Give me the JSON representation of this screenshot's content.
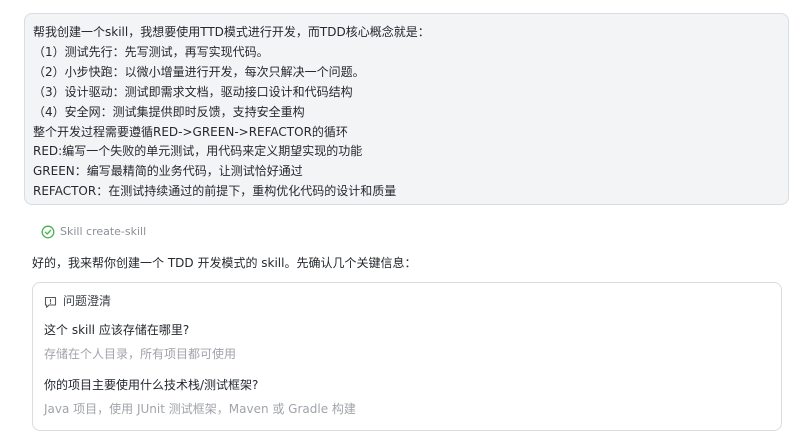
{
  "user_message": {
    "lines": [
      "帮我创建一个skill，我想要使用TTD模式进行开发，而TDD核心概念就是：",
      "（1）测试先行：先写测试，再写实现代码。",
      "（2）小步快跑：以微小增量进行开发，每次只解决一个问题。",
      "（3）设计驱动：测试即需求文档，驱动接口设计和代码结构",
      "（4）安全网：测试集提供即时反馈，支持安全重构",
      "整个开发过程需要遵循RED->GREEN->REFACTOR的循环",
      "RED:编写一个失败的单元测试，用代码来定义期望实现的功能",
      "GREEN：编写最精简的业务代码，让测试恰好通过",
      "REFACTOR：在测试持续通过的前提下，重构优化代码的设计和质量"
    ]
  },
  "skill_status": {
    "icon": "check-circle-icon",
    "label": "Skill create-skill",
    "color": "#4caf50"
  },
  "assistant_reply": {
    "text": "好的，我来帮你创建一个 TDD 开发模式的 skill。先确认几个关键信息："
  },
  "clarification": {
    "icon": "question-bubble-icon",
    "title": "问题澄清",
    "questions": [
      {
        "question": "这个 skill 应该存储在哪里?",
        "answer": "存储在个人目录，所有项目都可使用"
      },
      {
        "question": "你的项目主要使用什么技术栈/测试框架?",
        "answer": "Java 项目，使用 JUnit 测试框架，Maven 或 Gradle 构建"
      }
    ]
  }
}
